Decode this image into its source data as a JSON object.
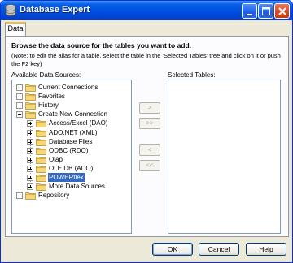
{
  "window": {
    "title": "Database Expert"
  },
  "tabs": [
    {
      "label": "Data",
      "selected": true
    }
  ],
  "panel": {
    "heading": "Browse the data source for the tables you want to add.",
    "note": "(Note: to edit the alias for a table, select the table in the 'Selected Tables' tree and click on it or push the F2 key)",
    "available_label": "Available Data Sources:",
    "selected_label": "Selected Tables:"
  },
  "tree": [
    {
      "label": "Current Connections",
      "level": 0,
      "expander": "plus"
    },
    {
      "label": "Favorites",
      "level": 0,
      "expander": "plus"
    },
    {
      "label": "History",
      "level": 0,
      "expander": "plus"
    },
    {
      "label": "Create New Connection",
      "level": 0,
      "expander": "minus"
    },
    {
      "label": "Access/Excel (DAO)",
      "level": 1,
      "expander": "plus"
    },
    {
      "label": "ADO.NET (XML)",
      "level": 1,
      "expander": "plus"
    },
    {
      "label": "Database Files",
      "level": 1,
      "expander": "plus"
    },
    {
      "label": "ODBC (RDO)",
      "level": 1,
      "expander": "plus"
    },
    {
      "label": "Olap",
      "level": 1,
      "expander": "plus"
    },
    {
      "label": "OLE DB (ADO)",
      "level": 1,
      "expander": "plus"
    },
    {
      "label": "POWERflex",
      "level": 1,
      "expander": "plus",
      "selected": true
    },
    {
      "label": "More Data Sources",
      "level": 1,
      "expander": "plus"
    },
    {
      "label": "Repository",
      "level": 0,
      "expander": "plus"
    }
  ],
  "transfer_buttons": {
    "add_one": ">",
    "add_all": ">>",
    "remove_one": "<",
    "remove_all": "<<"
  },
  "footer": {
    "ok_label": "OK",
    "cancel_label": "Cancel",
    "help_label": "Help"
  },
  "colors": {
    "titlebar": "#0054e3",
    "selection": "#316ac5",
    "folder": "#f7d774",
    "tab_highlight": "#f5ba3e"
  },
  "icons": {
    "app": "database-icon",
    "folder": "folder-icon"
  }
}
